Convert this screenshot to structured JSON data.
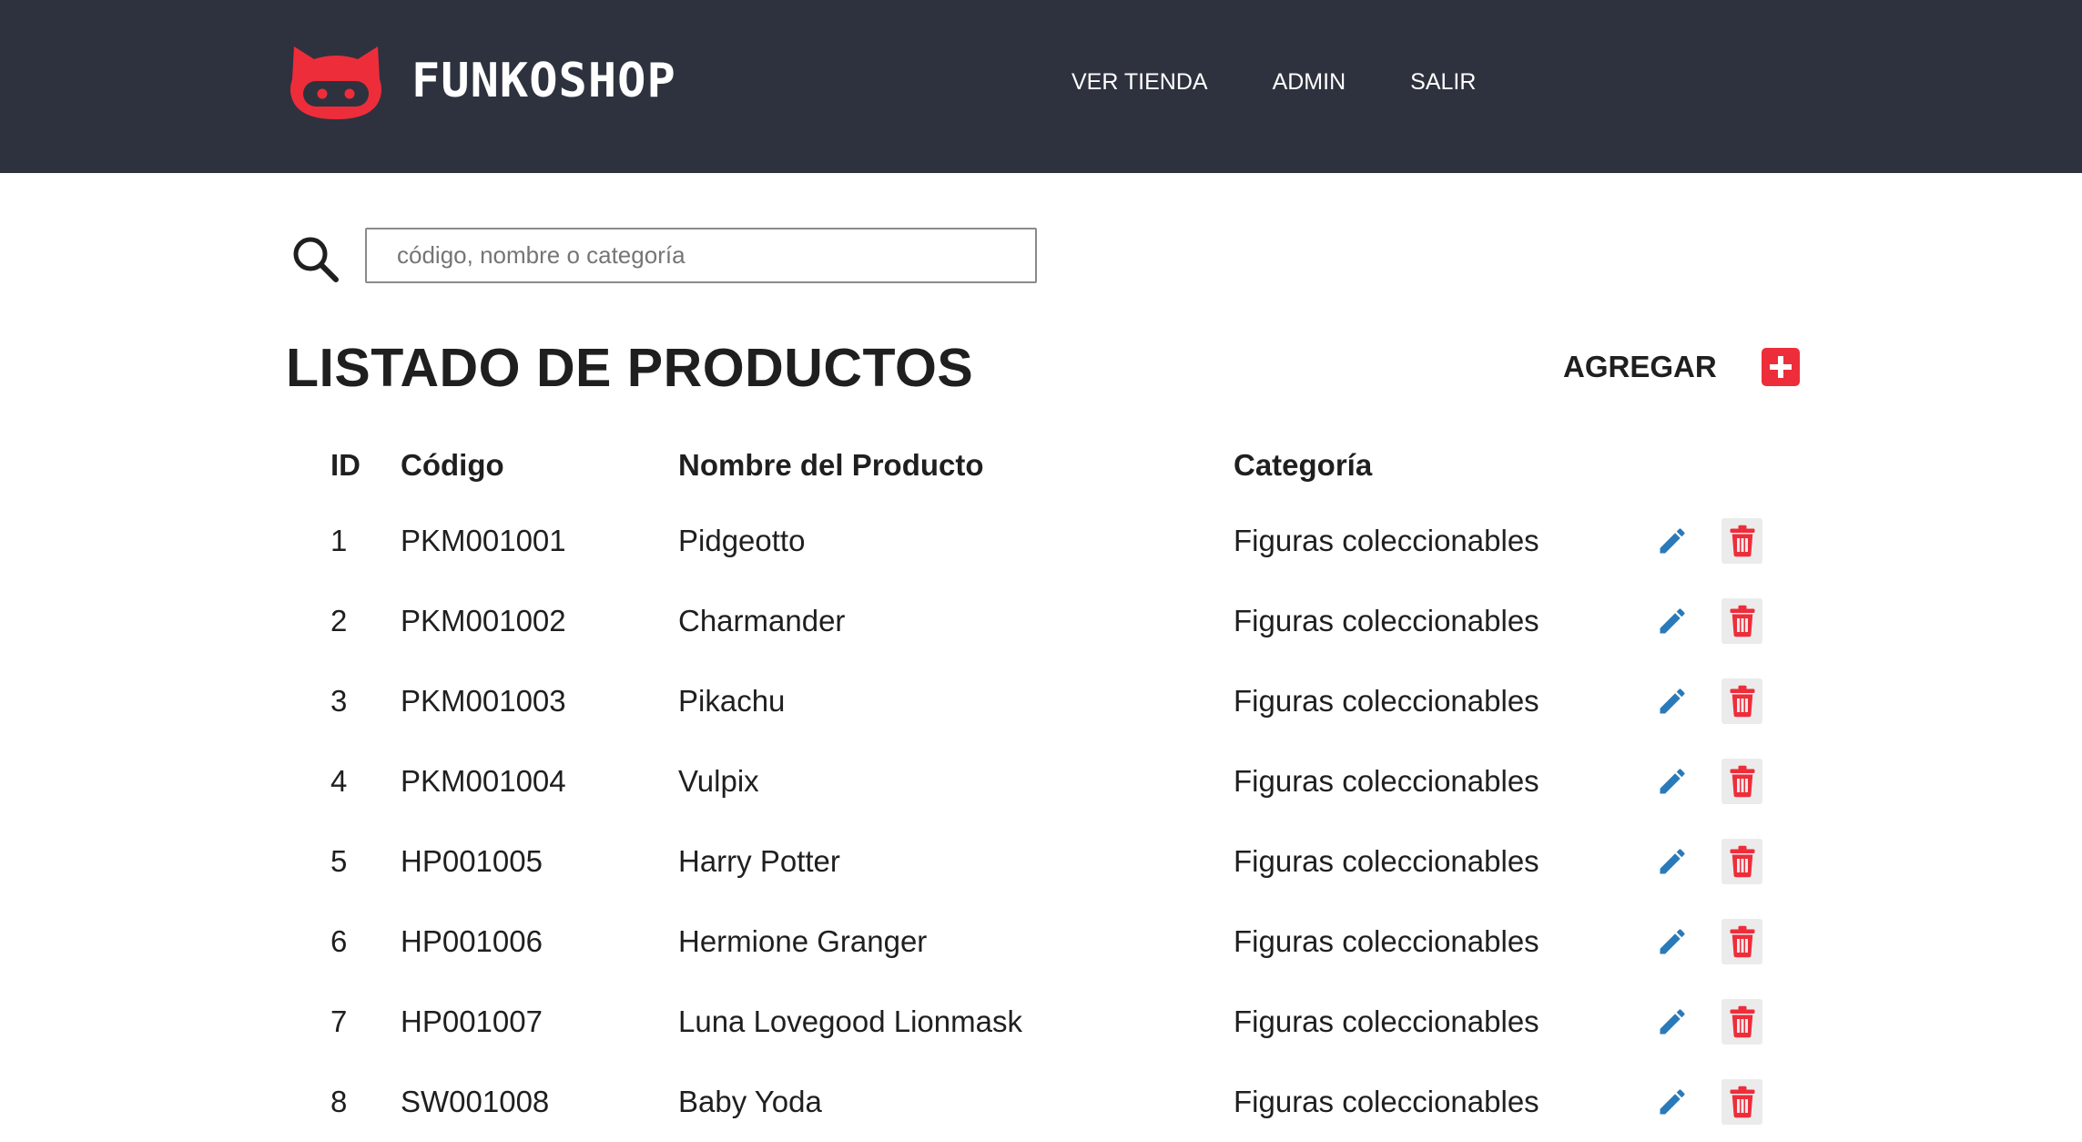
{
  "brand": {
    "name": "FUNKOSHOP",
    "logo_icon": "cat-face-icon",
    "accent_color": "#ee2d3a",
    "header_color": "#2e323e"
  },
  "nav": {
    "items": [
      {
        "label": "VER TIENDA"
      },
      {
        "label": "ADMIN"
      },
      {
        "label": "SALIR"
      }
    ]
  },
  "search": {
    "icon": "search-icon",
    "placeholder": "código, nombre o categoría",
    "value": ""
  },
  "page": {
    "title": "LISTADO DE PRODUCTOS",
    "add_label": "AGREGAR",
    "add_icon": "plus-square-icon"
  },
  "table": {
    "headers": {
      "id": "ID",
      "code": "Código",
      "name": "Nombre del Producto",
      "category": "Categoría"
    },
    "row_actions": {
      "edit_icon": "pencil-icon",
      "edit_color": "#2a7ab9",
      "delete_icon": "trash-icon",
      "delete_color": "#ee2d3a"
    },
    "rows": [
      {
        "id": "1",
        "code": "PKM001001",
        "name": "Pidgeotto",
        "category": "Figuras coleccionables"
      },
      {
        "id": "2",
        "code": "PKM001002",
        "name": "Charmander",
        "category": "Figuras coleccionables"
      },
      {
        "id": "3",
        "code": "PKM001003",
        "name": "Pikachu",
        "category": "Figuras coleccionables"
      },
      {
        "id": "4",
        "code": "PKM001004",
        "name": "Vulpix",
        "category": "Figuras coleccionables"
      },
      {
        "id": "5",
        "code": "HP001005",
        "name": "Harry Potter",
        "category": "Figuras coleccionables"
      },
      {
        "id": "6",
        "code": "HP001006",
        "name": "Hermione Granger",
        "category": "Figuras coleccionables"
      },
      {
        "id": "7",
        "code": "HP001007",
        "name": "Luna Lovegood Lionmask",
        "category": "Figuras coleccionables"
      },
      {
        "id": "8",
        "code": "SW001008",
        "name": "Baby Yoda",
        "category": "Figuras coleccionables"
      }
    ]
  }
}
